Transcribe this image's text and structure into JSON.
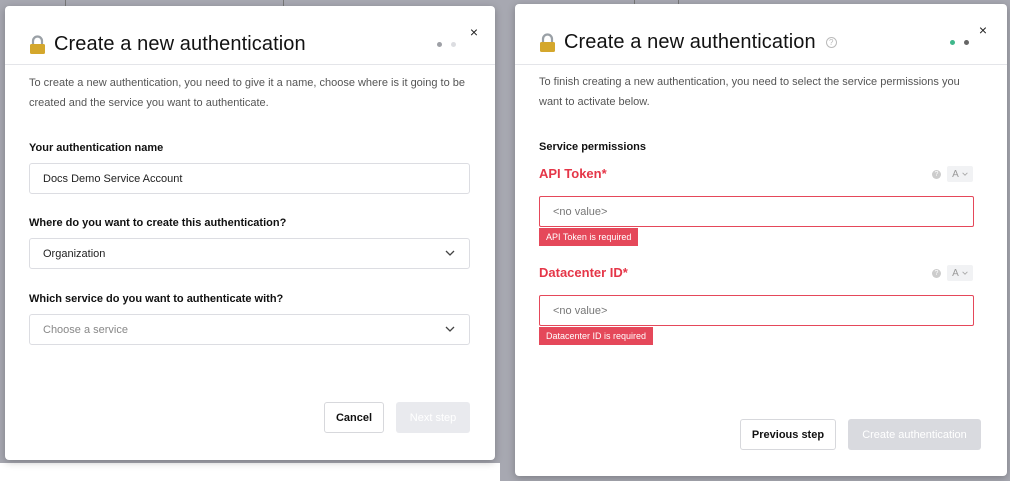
{
  "step1": {
    "title": "Create a new authentication",
    "close_glyph": "×",
    "description": "To create a new authentication, you need to give it a name, choose where is it going to be created and the service you want to authenticate.",
    "name_label": "Your authentication name",
    "name_value": "Docs Demo Service Account",
    "location_label": "Where do you want to create this authentication?",
    "location_value": "Organization",
    "service_label": "Which service do you want to authenticate with?",
    "service_placeholder": "Choose a service",
    "cancel_label": "Cancel",
    "next_label": "Next step",
    "steps": [
      {
        "active": true
      },
      {
        "active": false
      }
    ]
  },
  "step2": {
    "title": "Create a new authentication",
    "close_glyph": "×",
    "help_glyph": "?",
    "description": "To finish creating a new authentication, you need to select the service permissions you want to activate below.",
    "section_label": "Service permissions",
    "permissions": [
      {
        "label": "API Token*",
        "placeholder": "<no value>",
        "error": "API Token is required",
        "mode": "A"
      },
      {
        "label": "Datacenter ID*",
        "placeholder": "<no value>",
        "error": "Datacenter ID is required",
        "mode": "A"
      }
    ],
    "previous_label": "Previous step",
    "create_label": "Create authentication",
    "steps": [
      {
        "active": true
      },
      {
        "active": true
      }
    ]
  },
  "colors": {
    "accent_green": "#3fb78b",
    "error_red": "#e5485a",
    "dot_inactive": "#c9cacf",
    "dot_active_dark": "#666"
  },
  "icons": [
    "lock-icon",
    "close-icon",
    "chevron-down-icon",
    "help-circle-icon"
  ]
}
